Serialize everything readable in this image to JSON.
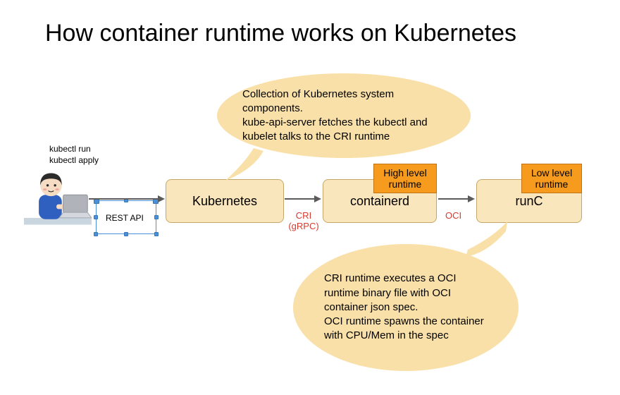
{
  "title": "How container runtime works on Kubernetes",
  "user_commands": {
    "line1": "kubectl run",
    "line2": "kubectl apply"
  },
  "rest_api_label": "REST API",
  "nodes": {
    "kubernetes": "Kubernetes",
    "containerd": "containerd",
    "runc": "runC"
  },
  "badges": {
    "high": "High level\nruntime",
    "low": "Low level\nruntime"
  },
  "interfaces": {
    "cri": "CRI\n(gRPC)",
    "oci": "OCI"
  },
  "callouts": {
    "top": "Collection of Kubernetes system components.\nkube-api-server fetches the kubectl and kubelet talks to the CRI runtime",
    "bottom": "CRI runtime executes a OCI runtime binary file with OCI container json spec.\nOCI runtime spawns the container with CPU/Mem in the spec"
  }
}
